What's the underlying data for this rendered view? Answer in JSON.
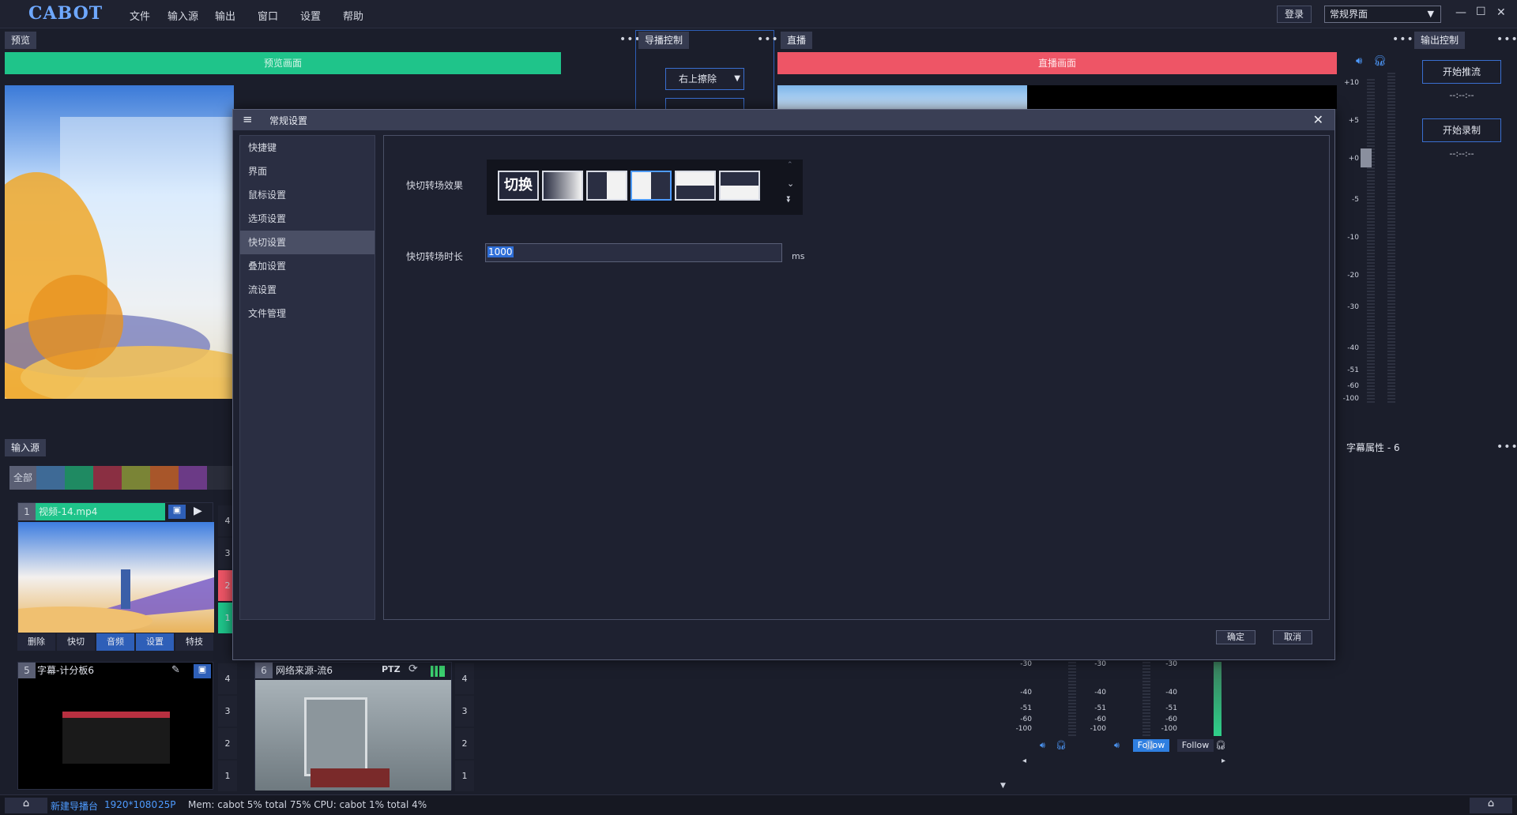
{
  "app": {
    "logo": "CABOT",
    "menu": [
      "文件",
      "输入源",
      "输出",
      "窗口",
      "设置",
      "帮助"
    ],
    "login": "登录",
    "layout_mode": "常规界面"
  },
  "preview": {
    "tab": "预览",
    "bar_label": "预览画面"
  },
  "director": {
    "tab": "导播控制",
    "transition_select": "右上擦除"
  },
  "live": {
    "tab": "直播",
    "bar_label": "直播画面",
    "scale": [
      "+10",
      "+5",
      "+0",
      "-5",
      "-10",
      "-20",
      "-30",
      "-40",
      "-51",
      "-60",
      "-100"
    ]
  },
  "output_control": {
    "tab": "输出控制",
    "start_stream": "开始推流",
    "stream_time": "--:--:--",
    "start_record": "开始录制",
    "record_time": "--:--:--"
  },
  "subtitle_props": {
    "title": "字幕属性 - 6"
  },
  "sources": {
    "tab": "输入源",
    "filter_all": "全部",
    "filter_colors": [
      "#3e6a96",
      "#1f8a62",
      "#8a2f42",
      "#7a8436",
      "#a8562a",
      "#6b3a86",
      "#2a2d3a"
    ],
    "source1": {
      "index": "1",
      "name": "视频-14.mp4",
      "actions": [
        "删除",
        "快切",
        "音频",
        "设置",
        "特技"
      ],
      "slots": [
        "4",
        "3",
        "2",
        "1"
      ]
    },
    "source5": {
      "index": "5",
      "name": "字幕-计分板6",
      "slots": [
        "4",
        "3",
        "2",
        "1"
      ]
    },
    "source6": {
      "index": "6",
      "name": "网络来源-流6",
      "ptz": "PTZ",
      "slots": [
        "4",
        "3",
        "2",
        "1"
      ]
    }
  },
  "mixer": {
    "scale": [
      "-30",
      "-40",
      "-51",
      "-60",
      "-100"
    ],
    "follow1": "Follow",
    "follow2": "Follow"
  },
  "statusbar": {
    "name": "新建导播台",
    "resolution": "1920*1080",
    "fps": "25P",
    "stats": "Mem: cabot 5% total 75% CPU: cabot 1% total 4%"
  },
  "dialog": {
    "title": "常规设置",
    "sidebar": [
      "快捷键",
      "界面",
      "鼠标设置",
      "选项设置",
      "快切设置",
      "叠加设置",
      "流设置",
      "文件管理"
    ],
    "active_index": 4,
    "transition_effect_label": "快切转场效果",
    "effect_cut_label": "切换",
    "duration_label": "快切转场时长",
    "duration_value": "1000",
    "duration_unit": "ms",
    "ok": "确定",
    "cancel": "取消"
  }
}
